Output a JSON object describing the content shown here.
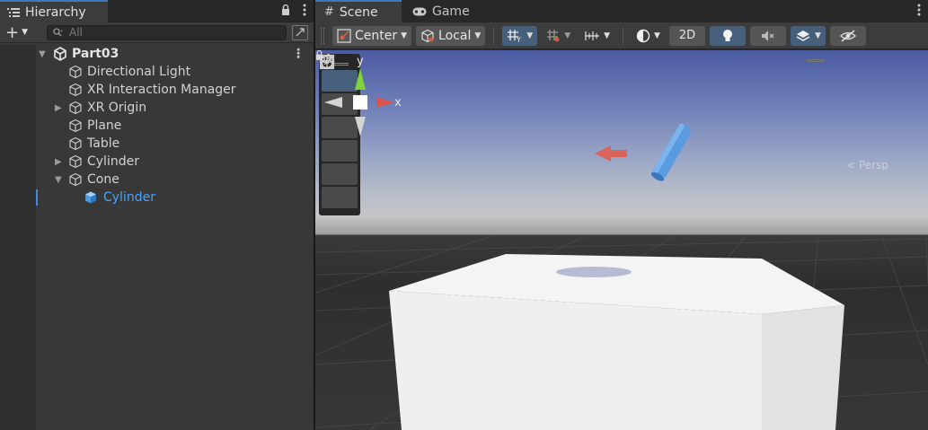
{
  "hierarchy": {
    "tab_label": "Hierarchy",
    "search_placeholder": "All",
    "scene_name": "Part03",
    "items": [
      {
        "label": "Directional Light"
      },
      {
        "label": "XR Interaction Manager"
      },
      {
        "label": "XR Origin"
      },
      {
        "label": "Plane"
      },
      {
        "label": "Table"
      },
      {
        "label": "Cylinder"
      },
      {
        "label": "Cone"
      },
      {
        "label": "Cylinder"
      }
    ]
  },
  "scene": {
    "tabs": [
      {
        "label": "Scene"
      },
      {
        "label": "Game"
      }
    ],
    "toolbar": {
      "pivot_label": "Center",
      "space_label": "Local",
      "mode_2d_label": "2D"
    },
    "gizmo": {
      "y_label": "y",
      "x_label": "x",
      "projection_label": "Persp"
    }
  },
  "colors": {
    "accent": "#3a79bb",
    "selected_text": "#4aa3ff",
    "cylinder": "#5a9be0",
    "x_axis": "#d9534f",
    "y_axis": "#7fd23a"
  }
}
